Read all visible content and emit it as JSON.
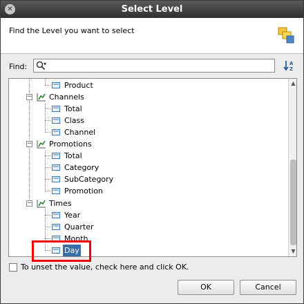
{
  "window": {
    "title": "Select Level"
  },
  "header": {
    "text": "Find the Level you want to select",
    "icon": "levels-icon"
  },
  "find": {
    "label": "Find:",
    "value": ""
  },
  "tree": {
    "rows": [
      {
        "label": "Product",
        "type": "level"
      },
      {
        "label": "Channels",
        "type": "hierarchy"
      },
      {
        "label": "Total",
        "type": "level"
      },
      {
        "label": "Class",
        "type": "level"
      },
      {
        "label": "Channel",
        "type": "level"
      },
      {
        "label": "Promotions",
        "type": "hierarchy"
      },
      {
        "label": "Total",
        "type": "level"
      },
      {
        "label": "Category",
        "type": "level"
      },
      {
        "label": "SubCategory",
        "type": "level"
      },
      {
        "label": "Promotion",
        "type": "level"
      },
      {
        "label": "Times",
        "type": "hierarchy"
      },
      {
        "label": "Year",
        "type": "level"
      },
      {
        "label": "Quarter",
        "type": "level"
      },
      {
        "label": "Month",
        "type": "level"
      },
      {
        "label": "Day",
        "type": "level",
        "selected": true
      }
    ]
  },
  "unset": {
    "text": "To unset the value, check here and click OK."
  },
  "buttons": {
    "ok": "OK",
    "cancel": "Cancel"
  },
  "colors": {
    "selection": "#3a6ea5",
    "highlight": "#ee0000",
    "titlebar": "#3a3a3a"
  }
}
